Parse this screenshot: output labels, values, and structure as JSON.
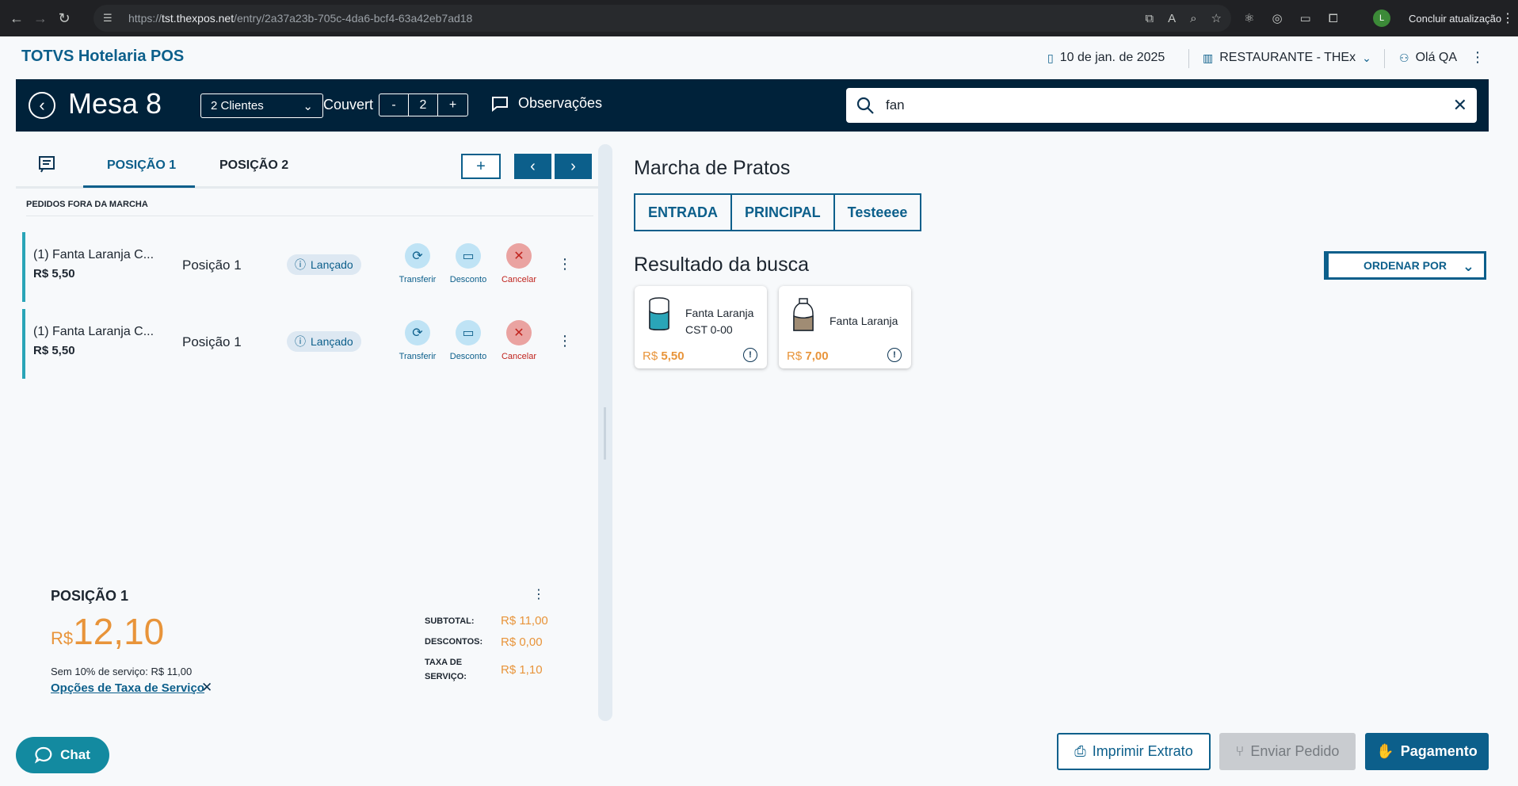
{
  "browser": {
    "url_prefix": "https://",
    "url_host": "tst.thexpos.net",
    "url_path": "/entry/2a37a23b-705c-4da6-bcf4-63a42eb7ad18",
    "avatar_letter": "L",
    "update_label": "Concluir atualização"
  },
  "header": {
    "brand": "TOTVS Hotelaria POS",
    "date": "10 de jan. de 2025",
    "restaurant": "RESTAURANTE - THEx",
    "user": "Olá QA"
  },
  "topbar": {
    "title": "Mesa 8",
    "clients": "2 Clientes",
    "couvert_label": "Couvert",
    "couvert_minus": "-",
    "couvert_value": "2",
    "couvert_plus": "+",
    "observacoes": "Observações",
    "search_value": "fan"
  },
  "positions": {
    "tabs": [
      {
        "label": "POSIÇÃO 1",
        "active": true
      },
      {
        "label": "POSIÇÃO 2",
        "active": false
      }
    ],
    "add_label": "+",
    "section_label": "PEDIDOS FORA DA MARCHA"
  },
  "orders": [
    {
      "name": "(1)  Fanta Laranja C...",
      "price": "R$ 5,50",
      "position": "Posição 1",
      "status": "Lançado",
      "transfer": "Transferir",
      "discount": "Desconto",
      "cancel": "Cancelar"
    },
    {
      "name": "(1)  Fanta Laranja C...",
      "price": "R$ 5,50",
      "position": "Posição 1",
      "status": "Lançado",
      "transfer": "Transferir",
      "discount": "Desconto",
      "cancel": "Cancelar"
    }
  ],
  "summary": {
    "title": "POSIÇÃO 1",
    "currency": "R$",
    "total": "12,10",
    "sem_taxa": "Sem 10% de serviço: R$ 11,00",
    "opcoes": "Opções de Taxa de Serviço",
    "subtotal_label": "SUBTOTAL:",
    "subtotal_value": "R$ 11,00",
    "descontos_label": "DESCONTOS:",
    "descontos_value": "R$ 0,00",
    "taxa_label_1": "TAXA DE",
    "taxa_label_2": "SERVIÇO:",
    "taxa_value": "R$ 1,10"
  },
  "marcha": {
    "title": "Marcha de Pratos",
    "courses": [
      "ENTRADA",
      "PRINCIPAL",
      "Testeeee"
    ]
  },
  "results": {
    "title": "Resultado da busca",
    "sort_label": "ORDENAR POR",
    "products": [
      {
        "line1": "Fanta Laranja",
        "line2": "CST 0-00",
        "currency": "R$",
        "price": "5,50"
      },
      {
        "line1": "Fanta Laranja",
        "line2": "",
        "currency": "R$",
        "price": "7,00"
      }
    ]
  },
  "footer": {
    "chat": "Chat",
    "imprimir": "Imprimir Extrato",
    "enviar": "Enviar Pedido",
    "pagamento": "Pagamento"
  },
  "colors": {
    "primary": "#0c5f8b",
    "topbar": "#00223a",
    "accent_price": "#e8943a",
    "order_border": "#2aa5b8",
    "cancel_red": "#c0241e"
  }
}
